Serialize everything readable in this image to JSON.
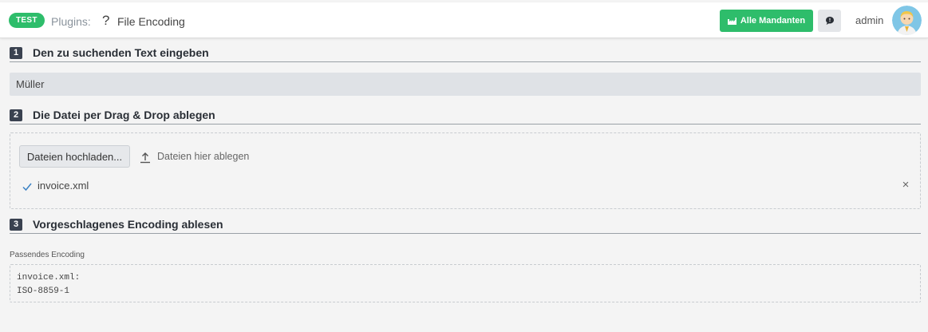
{
  "header": {
    "env_badge": "TEST",
    "breadcrumb_plugins": "Plugins:",
    "help_glyph": "?",
    "page_title": "File Encoding",
    "mandanten_button": "Alle Mandanten",
    "username": "admin"
  },
  "steps": [
    {
      "number": "1",
      "title": "Den zu suchenden Text eingeben"
    },
    {
      "number": "2",
      "title": "Die Datei per Drag & Drop ablegen"
    },
    {
      "number": "3",
      "title": "Vorgeschlagenes Encoding ablesen"
    }
  ],
  "search": {
    "value": "Müller"
  },
  "upload": {
    "button_label": "Dateien hochladen...",
    "drop_hint": "Dateien hier ablegen",
    "file_name": "invoice.xml",
    "remove_glyph": "×"
  },
  "result": {
    "label": "Passendes Encoding",
    "lines": [
      "invoice.xml:",
      "ISO-8859-1"
    ]
  },
  "icons": {
    "mandanten": "factory-icon",
    "chat": "chat-icon",
    "upload": "upload-icon",
    "check": "check-icon",
    "remove": "close-icon"
  },
  "colors": {
    "accent_green": "#2ebd6b",
    "step_badge": "#3a4250",
    "check_blue": "#3b82c4"
  }
}
